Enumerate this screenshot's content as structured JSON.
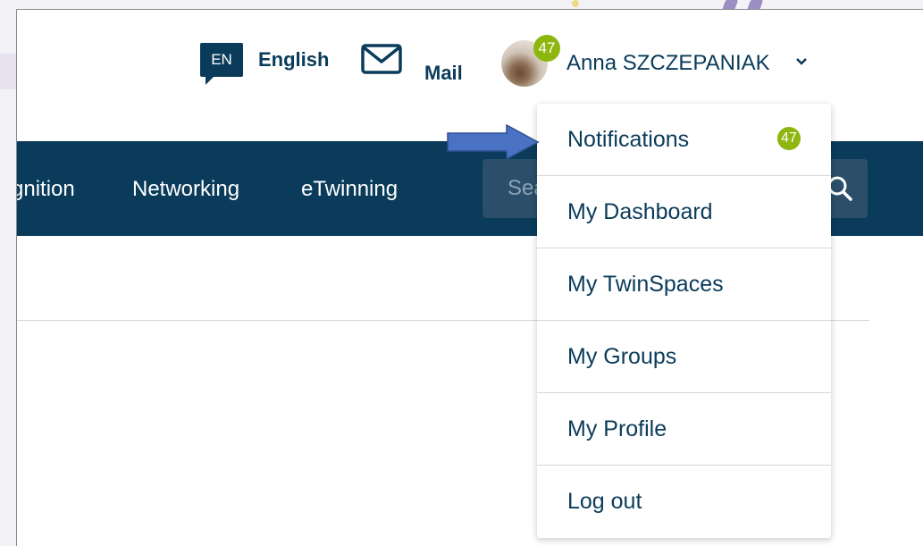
{
  "header": {
    "language": {
      "code": "EN",
      "label": "English"
    },
    "mail_label": "Mail",
    "user": {
      "name": "Anna SZCZEPANIAK",
      "notification_count": "47"
    }
  },
  "nav": {
    "items": [
      "gnition",
      "Networking",
      "eTwinning"
    ],
    "search_placeholder": "Search"
  },
  "dropdown": {
    "items": [
      {
        "label": "Notifications",
        "badge": "47"
      },
      {
        "label": "My Dashboard"
      },
      {
        "label": "My TwinSpaces"
      },
      {
        "label": "My Groups"
      },
      {
        "label": "My Profile"
      },
      {
        "label": "Log out"
      }
    ]
  },
  "colors": {
    "brand_navy": "#0a3b5a",
    "badge_green": "#8db60e",
    "annotation_arrow": "#4a72c4"
  },
  "icons": [
    "envelope-icon",
    "chevron-down-icon",
    "search-icon",
    "annotation-arrow"
  ]
}
